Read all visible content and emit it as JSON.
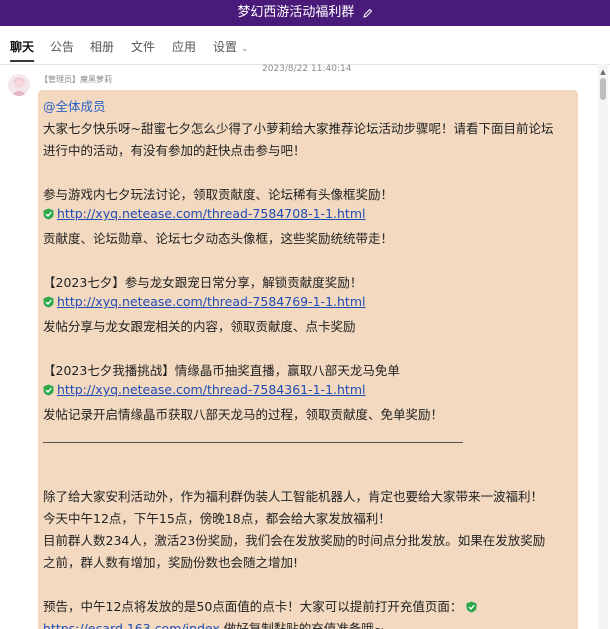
{
  "window": {
    "title": "梦幻西游活动福利群"
  },
  "tabs": [
    {
      "label": "聊天",
      "active": true
    },
    {
      "label": "公告"
    },
    {
      "label": "相册"
    },
    {
      "label": "文件"
    },
    {
      "label": "应用"
    },
    {
      "label": "设置"
    }
  ],
  "message": {
    "timestamp": "2023/8/22 11:40:14",
    "sender": "【管理员】魔黑萝莉",
    "lines": {
      "mention": "@全体成员",
      "l1": "大家七夕快乐呀~甜蜜七夕怎么少得了小萝莉给大家推荐论坛活动步骤呢！请看下面目前论坛",
      "l2": "进行中的活动，有没有参加的赶快点击参与吧！",
      "s1_title": "参与游戏内七夕玩法讨论，领取贡献度、论坛稀有头像框奖励！",
      "s1_link": "http://xyq.netease.com/thread-7584708-1-1.html",
      "s1_desc": "贡献度、论坛勋章、论坛七夕动态头像框，这些奖励统统带走！",
      "s2_title": "【2023七夕】参与龙女跟宠日常分享，解锁贡献度奖励！",
      "s2_link": "http://xyq.netease.com/thread-7584769-1-1.html",
      "s2_desc": "发帖分享与龙女跟宠相关的内容，领取贡献度、点卡奖励",
      "s3_title": "【2023七夕我播挑战】情缘晶币抽奖直播，赢取八部天龙马免单",
      "s3_link": "http://xyq.netease.com/thread-7584361-1-1.html",
      "s3_desc": "发帖记录开启情缘晶币获取八部天龙马的过程，领取贡献度、免单奖励！",
      "p1": "除了给大家安利活动外，作为福利群伪装人工智能机器人，肯定也要给大家带来一波福利！",
      "p2": "今天中午12点，下午15点，傍晚18点，都会给大家发放福利！",
      "p3": "目前群人数234人，激活23份奖励，我们会在发放奖励的时间点分批发放。如果在发放奖励",
      "p4": "之前，群人数有增加，奖励份数也会随之增加!",
      "p5": "预告，中午12点将发放的是50点面值的点卡！大家可以提前打开充值页面：",
      "p6_link": "https://ecard.163.com/index",
      "p6_rest": " 做好复制黏贴的充值准备哦~"
    }
  },
  "icons": {
    "edit": "pencil-icon",
    "safe": "shield-check-icon",
    "dropdown": "chevron-down-icon",
    "scroll": "scroll-up-icon"
  },
  "colors": {
    "titlebar": "#4a1a7a",
    "bubble": "#f2d9c0",
    "link": "#1f4db5",
    "shield": "#2aa84a"
  }
}
